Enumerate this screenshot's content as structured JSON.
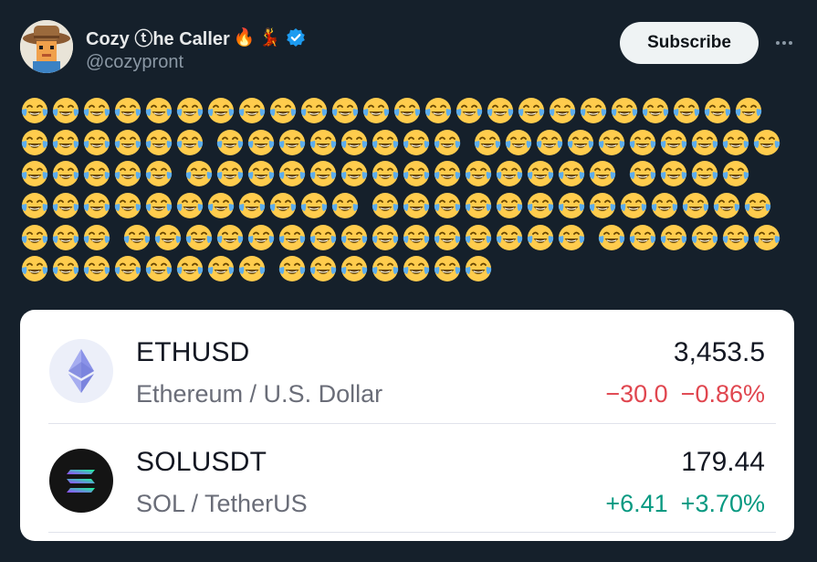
{
  "author": {
    "display_name": "Cozy ⓣhe Caller",
    "name_emojis": [
      "🔥",
      "💃"
    ],
    "handle": "@cozypront",
    "verified": true
  },
  "actions": {
    "subscribe_label": "Subscribe",
    "more_icon": "more-horizontal-icon"
  },
  "tweet": {
    "emoji": "face-with-tears-of-joy",
    "emoji_rows": [
      [
        24
      ],
      [
        6,
        8,
        10
      ],
      [
        5,
        14,
        4
      ],
      [
        11,
        13
      ],
      [
        3,
        15,
        6
      ],
      [
        8,
        7
      ]
    ]
  },
  "tickers": [
    {
      "symbol": "ETHUSD",
      "description": "Ethereum / U.S. Dollar",
      "price": "3,453.5",
      "change": "−30.0",
      "change_pct": "−0.86%",
      "direction": "down",
      "icon": "ethereum-logo-icon"
    },
    {
      "symbol": "SOLUSDT",
      "description": "SOL / TetherUS",
      "price": "179.44",
      "change": "+6.41",
      "change_pct": "+3.70%",
      "direction": "up",
      "icon": "solana-logo-icon"
    }
  ],
  "colors": {
    "background": "#15202b",
    "negative": "#e0464f",
    "positive": "#089981",
    "verified": "#1d9bf0"
  }
}
